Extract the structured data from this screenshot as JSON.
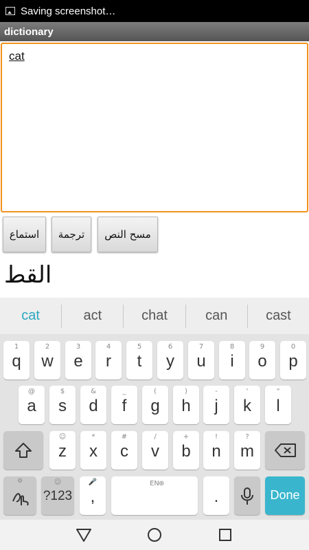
{
  "status_bar": {
    "text": "Saving screenshot…",
    "icon": "screenshot-icon"
  },
  "app": {
    "title": "dictionary"
  },
  "input": {
    "value": "cat"
  },
  "buttons": {
    "listen": "استماع",
    "translate": "ترجمة",
    "clear": "مسح النص"
  },
  "result": {
    "text": "القط"
  },
  "suggestions": [
    "cat",
    "act",
    "chat",
    "can",
    "cast"
  ],
  "keyboard": {
    "row1": [
      {
        "k": "q",
        "h": "1"
      },
      {
        "k": "w",
        "h": "2"
      },
      {
        "k": "e",
        "h": "3"
      },
      {
        "k": "r",
        "h": "4"
      },
      {
        "k": "t",
        "h": "5"
      },
      {
        "k": "y",
        "h": "6"
      },
      {
        "k": "u",
        "h": "7"
      },
      {
        "k": "i",
        "h": "8"
      },
      {
        "k": "o",
        "h": "9"
      },
      {
        "k": "p",
        "h": "0"
      }
    ],
    "row2": [
      {
        "k": "a",
        "h": "@"
      },
      {
        "k": "s",
        "h": "$"
      },
      {
        "k": "d",
        "h": "&"
      },
      {
        "k": "f",
        "h": "_"
      },
      {
        "k": "g",
        "h": "("
      },
      {
        "k": "h",
        "h": ")"
      },
      {
        "k": "j",
        "h": "-"
      },
      {
        "k": "k",
        "h": "'"
      },
      {
        "k": "l",
        "h": "\""
      }
    ],
    "row3": [
      {
        "k": "z",
        "h": "☺"
      },
      {
        "k": "x",
        "h": "*"
      },
      {
        "k": "c",
        "h": "#"
      },
      {
        "k": "v",
        "h": "/"
      },
      {
        "k": "b",
        "h": "+"
      },
      {
        "k": "n",
        "h": "!"
      },
      {
        "k": "m",
        "h": "?"
      }
    ],
    "symbols_label": "?123",
    "comma": ",",
    "space_hint": "EN",
    "period": ".",
    "done_label": "Done"
  },
  "colors": {
    "accent": "#39b6cd",
    "focus_border": "#f0921a"
  }
}
